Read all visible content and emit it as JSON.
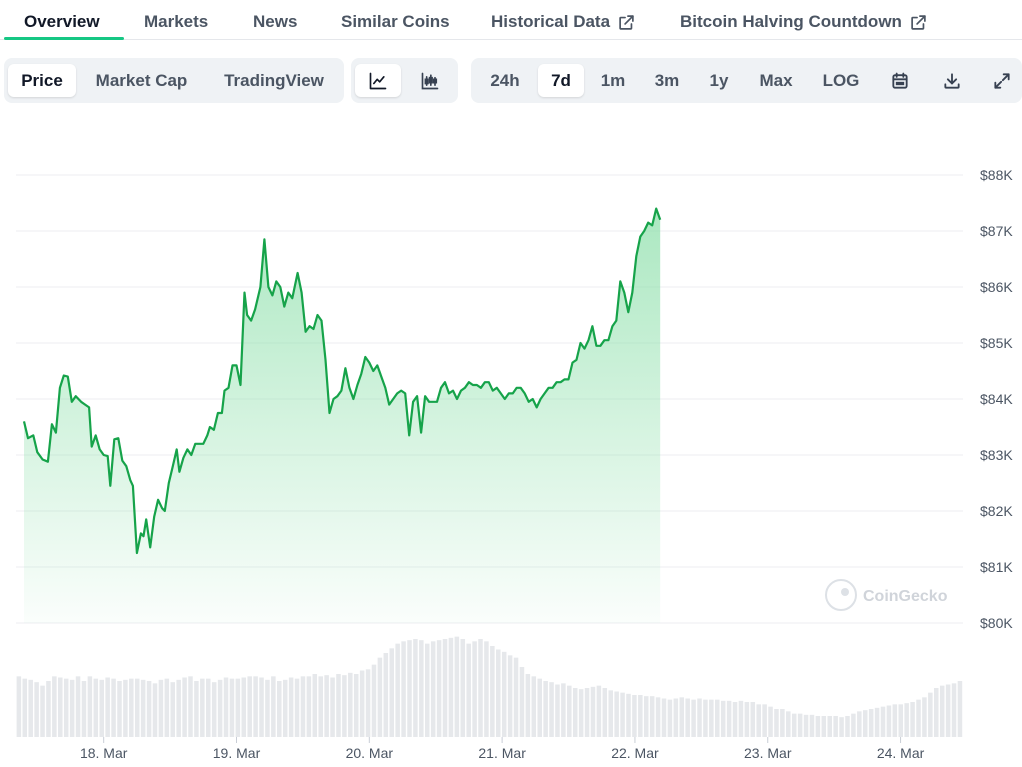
{
  "tabs": [
    {
      "label": "Overview",
      "external": false
    },
    {
      "label": "Markets",
      "external": false
    },
    {
      "label": "News",
      "external": false
    },
    {
      "label": "Similar Coins",
      "external": false
    },
    {
      "label": "Historical Data",
      "external": true
    },
    {
      "label": "Bitcoin Halving Countdown",
      "external": true
    }
  ],
  "active_tab": "Overview",
  "toolbar": {
    "metric_options": [
      "Price",
      "Market Cap",
      "TradingView"
    ],
    "active_metric": "Price",
    "chart_style_icons": [
      "line-chart-icon",
      "candlestick-icon"
    ],
    "active_chart_style": "line-chart-icon",
    "range_options": [
      "24h",
      "7d",
      "1m",
      "3m",
      "1y",
      "Max",
      "LOG"
    ],
    "active_range": "7d",
    "action_icons": [
      "calendar-icon",
      "download-icon",
      "expand-icon"
    ]
  },
  "colors": {
    "line": "#16a34a",
    "area_top": "#8fe0ac",
    "volume": "#e6e8eb",
    "grid": "#eceef1",
    "accent": "#16c784"
  },
  "watermark": "CoinGecko",
  "chart_data": {
    "type": "area",
    "title": "",
    "xlabel": "",
    "ylabel": "",
    "ylim": [
      80000,
      88000
    ],
    "y_ticks": [
      "$88K",
      "$87K",
      "$86K",
      "$85K",
      "$84K",
      "$83K",
      "$82K",
      "$81K",
      "$80K"
    ],
    "y_tick_values": [
      88000,
      87000,
      86000,
      85000,
      84000,
      83000,
      82000,
      81000,
      80000
    ],
    "x_ticks": [
      "18. Mar",
      "19. Mar",
      "20. Mar",
      "21. Mar",
      "22. Mar",
      "23. Mar",
      "24. Mar"
    ],
    "x_tick_days": [
      1,
      2,
      3,
      4,
      5,
      6,
      7
    ],
    "xlim_days": [
      0.4,
      7.44
    ],
    "grid": true,
    "legend": "none",
    "series": [
      {
        "points": [
          [
            0.4,
            83600
          ],
          [
            0.43,
            83300
          ],
          [
            0.47,
            83350
          ],
          [
            0.5,
            83050
          ],
          [
            0.54,
            82920
          ],
          [
            0.58,
            82880
          ],
          [
            0.61,
            83550
          ],
          [
            0.64,
            83400
          ],
          [
            0.67,
            84200
          ],
          [
            0.7,
            84420
          ],
          [
            0.73,
            84400
          ],
          [
            0.76,
            83950
          ],
          [
            0.79,
            84050
          ],
          [
            0.83,
            83950
          ],
          [
            0.86,
            83900
          ],
          [
            0.89,
            83850
          ],
          [
            0.91,
            83150
          ],
          [
            0.94,
            83350
          ],
          [
            0.97,
            83100
          ],
          [
            1.0,
            83000
          ],
          [
            1.03,
            82980
          ],
          [
            1.05,
            82450
          ],
          [
            1.08,
            83280
          ],
          [
            1.11,
            83300
          ],
          [
            1.14,
            82900
          ],
          [
            1.17,
            82800
          ],
          [
            1.2,
            82550
          ],
          [
            1.22,
            82450
          ],
          [
            1.25,
            81250
          ],
          [
            1.28,
            81600
          ],
          [
            1.3,
            81550
          ],
          [
            1.32,
            81850
          ],
          [
            1.35,
            81350
          ],
          [
            1.38,
            81900
          ],
          [
            1.41,
            82200
          ],
          [
            1.44,
            82050
          ],
          [
            1.46,
            82000
          ],
          [
            1.49,
            82500
          ],
          [
            1.52,
            82800
          ],
          [
            1.55,
            83100
          ],
          [
            1.57,
            82700
          ],
          [
            1.6,
            82950
          ],
          [
            1.63,
            83100
          ],
          [
            1.66,
            83000
          ],
          [
            1.69,
            83200
          ],
          [
            1.72,
            83200
          ],
          [
            1.75,
            83200
          ],
          [
            1.78,
            83350
          ],
          [
            1.8,
            83500
          ],
          [
            1.83,
            83450
          ],
          [
            1.86,
            83750
          ],
          [
            1.89,
            83750
          ],
          [
            1.91,
            84150
          ],
          [
            1.94,
            84200
          ],
          [
            1.97,
            84600
          ],
          [
            2.0,
            84600
          ],
          [
            2.03,
            84250
          ],
          [
            2.06,
            85900
          ],
          [
            2.08,
            85500
          ],
          [
            2.11,
            85400
          ],
          [
            2.14,
            85600
          ],
          [
            2.18,
            86000
          ],
          [
            2.21,
            86850
          ],
          [
            2.24,
            86000
          ],
          [
            2.27,
            85850
          ],
          [
            2.3,
            86100
          ],
          [
            2.33,
            86000
          ],
          [
            2.36,
            85650
          ],
          [
            2.39,
            85900
          ],
          [
            2.42,
            85800
          ],
          [
            2.46,
            86250
          ],
          [
            2.49,
            85900
          ],
          [
            2.52,
            85200
          ],
          [
            2.55,
            85300
          ],
          [
            2.58,
            85250
          ],
          [
            2.61,
            85500
          ],
          [
            2.64,
            85400
          ],
          [
            2.67,
            84700
          ],
          [
            2.7,
            83750
          ],
          [
            2.73,
            84000
          ],
          [
            2.76,
            84050
          ],
          [
            2.79,
            84150
          ],
          [
            2.82,
            84550
          ],
          [
            2.85,
            84200
          ],
          [
            2.88,
            84000
          ],
          [
            2.91,
            84250
          ],
          [
            2.94,
            84450
          ],
          [
            2.97,
            84750
          ],
          [
            3.0,
            84650
          ],
          [
            3.03,
            84500
          ],
          [
            3.06,
            84600
          ],
          [
            3.09,
            84400
          ],
          [
            3.12,
            84200
          ],
          [
            3.15,
            83900
          ],
          [
            3.18,
            84000
          ],
          [
            3.21,
            84100
          ],
          [
            3.24,
            84150
          ],
          [
            3.27,
            84100
          ],
          [
            3.3,
            83350
          ],
          [
            3.33,
            83950
          ],
          [
            3.36,
            84050
          ],
          [
            3.39,
            83400
          ],
          [
            3.42,
            84050
          ],
          [
            3.45,
            83950
          ],
          [
            3.48,
            83950
          ],
          [
            3.51,
            83950
          ],
          [
            3.54,
            84200
          ],
          [
            3.57,
            84300
          ],
          [
            3.6,
            84100
          ],
          [
            3.63,
            84150
          ],
          [
            3.66,
            84000
          ],
          [
            3.69,
            84150
          ],
          [
            3.72,
            84200
          ],
          [
            3.75,
            84300
          ],
          [
            3.78,
            84250
          ],
          [
            3.81,
            84250
          ],
          [
            3.84,
            84200
          ],
          [
            3.87,
            84300
          ],
          [
            3.9,
            84300
          ],
          [
            3.93,
            84150
          ],
          [
            3.96,
            84200
          ],
          [
            3.99,
            84100
          ],
          [
            4.02,
            84000
          ],
          [
            4.05,
            84100
          ],
          [
            4.08,
            84100
          ],
          [
            4.11,
            84200
          ],
          [
            4.14,
            84200
          ],
          [
            4.17,
            84100
          ],
          [
            4.2,
            83950
          ],
          [
            4.23,
            84000
          ],
          [
            4.26,
            83850
          ],
          [
            4.29,
            84000
          ],
          [
            4.32,
            84100
          ],
          [
            4.35,
            84200
          ],
          [
            4.38,
            84200
          ],
          [
            4.41,
            84300
          ],
          [
            4.44,
            84300
          ],
          [
            4.47,
            84350
          ],
          [
            4.5,
            84350
          ],
          [
            4.53,
            84650
          ],
          [
            4.56,
            84700
          ],
          [
            4.59,
            85000
          ],
          [
            4.62,
            84900
          ],
          [
            4.65,
            85050
          ],
          [
            4.68,
            85300
          ],
          [
            4.71,
            84950
          ],
          [
            4.74,
            84950
          ],
          [
            4.77,
            85050
          ],
          [
            4.8,
            85050
          ],
          [
            4.83,
            85300
          ],
          [
            4.86,
            85400
          ],
          [
            4.89,
            86100
          ],
          [
            4.92,
            85900
          ],
          [
            4.95,
            85550
          ],
          [
            4.98,
            85900
          ],
          [
            5.01,
            86550
          ],
          [
            5.04,
            86900
          ],
          [
            5.07,
            87000
          ],
          [
            5.1,
            87150
          ],
          [
            5.13,
            87100
          ],
          [
            5.16,
            87400
          ],
          [
            5.19,
            87200
          ]
        ]
      }
    ],
    "volume": [
      52,
      50,
      49,
      47,
      44,
      48,
      52,
      51,
      50,
      49,
      52,
      48,
      52,
      50,
      49,
      51,
      50,
      48,
      49,
      50,
      50,
      49,
      48,
      46,
      49,
      50,
      47,
      49,
      51,
      52,
      48,
      50,
      50,
      47,
      49,
      51,
      50,
      50,
      51,
      52,
      52,
      51,
      49,
      52,
      48,
      49,
      51,
      50,
      52,
      52,
      54,
      52,
      53,
      51,
      54,
      53,
      55,
      54,
      57,
      58,
      62,
      68,
      72,
      76,
      80,
      82,
      83,
      84,
      83,
      80,
      82,
      83,
      84,
      85,
      86,
      84,
      80,
      82,
      84,
      82,
      78,
      75,
      73,
      70,
      68,
      60,
      54,
      52,
      50,
      48,
      47,
      45,
      46,
      44,
      42,
      41,
      42,
      43,
      44,
      42,
      40,
      39,
      38,
      37,
      36,
      36,
      35,
      35,
      34,
      33,
      32,
      33,
      34,
      33,
      32,
      33,
      32,
      32,
      32,
      31,
      31,
      30,
      31,
      30,
      30,
      28,
      28,
      26,
      24,
      24,
      22,
      20,
      20,
      19,
      19,
      18,
      18,
      18,
      18,
      17,
      18,
      20,
      22,
      23,
      24,
      25,
      26,
      27,
      28,
      28,
      29,
      30,
      32,
      34,
      38,
      42,
      44,
      45,
      46,
      48
    ],
    "volume_max": 90
  }
}
